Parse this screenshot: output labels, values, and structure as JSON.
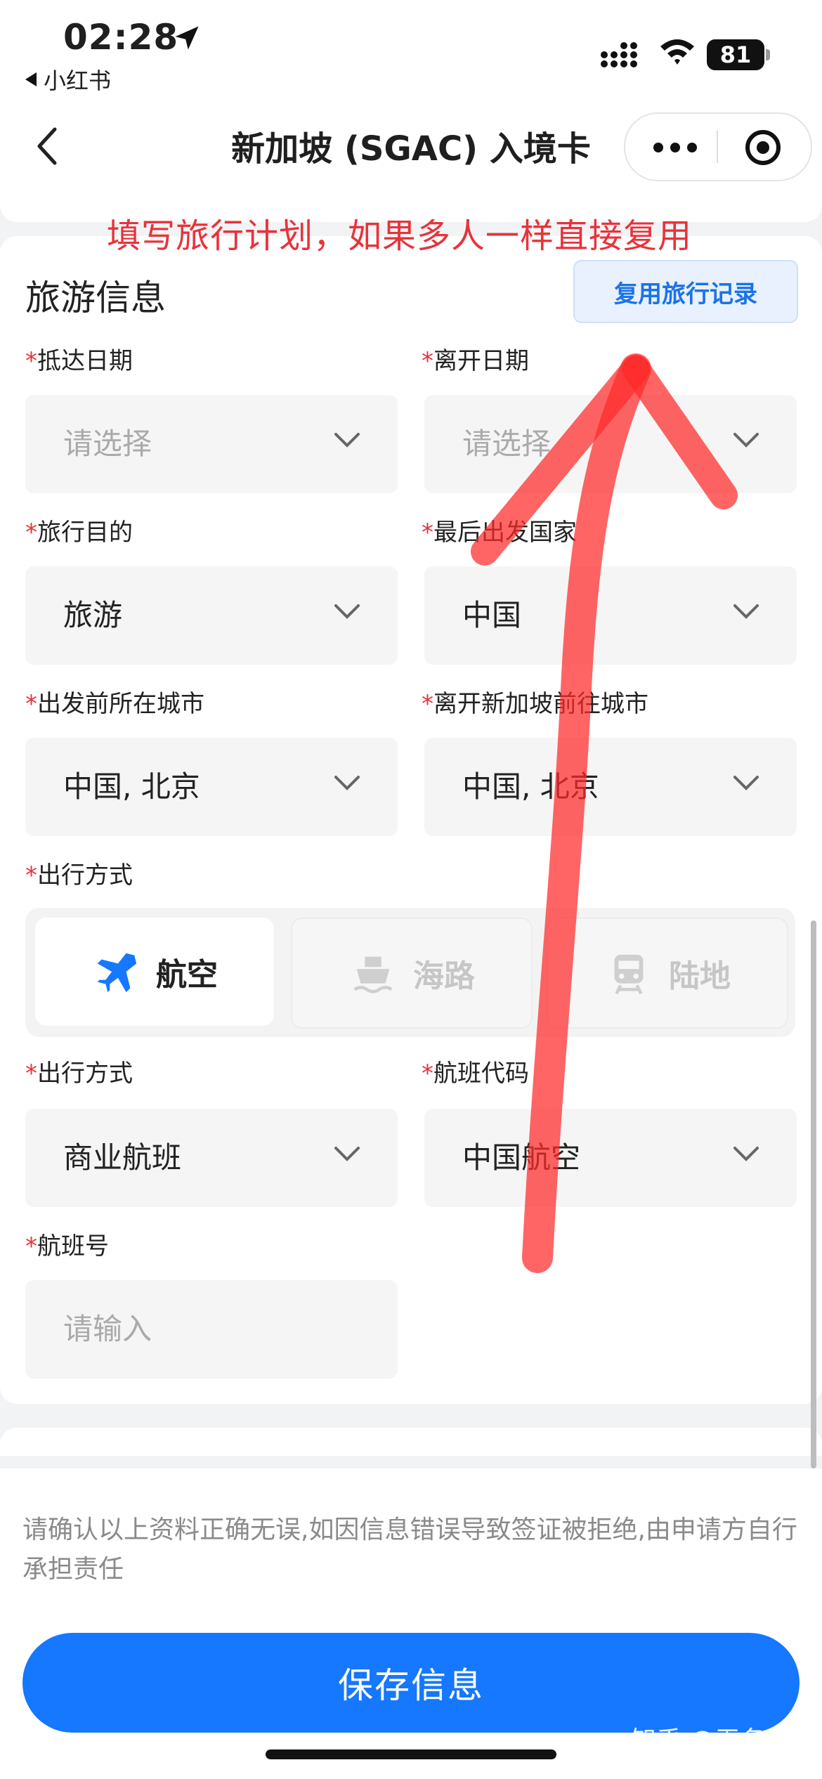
{
  "status_bar": {
    "time": "02:28",
    "back_app": "小红书",
    "battery": "81"
  },
  "nav": {
    "title": "新加坡 (SGAC) 入境卡"
  },
  "annotation": "填写旅行计划，如果多人一样直接复用",
  "section": {
    "title": "旅游信息",
    "reuse_label": "复用旅行记录"
  },
  "required_mark": "*",
  "fields": {
    "arrival_date": {
      "label": "抵达日期",
      "value": "请选择"
    },
    "departure_date": {
      "label": "离开日期",
      "value": "请选择"
    },
    "purpose": {
      "label": "旅行目的",
      "value": "旅游"
    },
    "last_country": {
      "label": "最后出发国家",
      "value": "中国"
    },
    "origin_city": {
      "label": "出发前所在城市",
      "value": "中国, 北京"
    },
    "next_city": {
      "label": "离开新加坡前往城市",
      "value": "中国, 北京"
    },
    "transport_mode_label": "出行方式",
    "travel_type": {
      "label": "出行方式",
      "value": "商业航班"
    },
    "airline_code": {
      "label": "航班代码",
      "value": "中国航空"
    },
    "flight_no": {
      "label": "航班号",
      "placeholder": "请输入"
    }
  },
  "modes": [
    {
      "label": "航空",
      "icon": "airplane-icon",
      "active": true
    },
    {
      "label": "海路",
      "icon": "ship-icon",
      "active": false
    },
    {
      "label": "陆地",
      "icon": "train-icon",
      "active": false
    }
  ],
  "notice": "请确认以上资料正确无误,如因信息错误导致签证被拒绝,由申请方自行承担责任",
  "save_button": "保存信息",
  "watermark": "知乎 @无名小p",
  "colors": {
    "primary": "#1677ff",
    "required": "#e8323a",
    "annotation": "#e8323a"
  }
}
